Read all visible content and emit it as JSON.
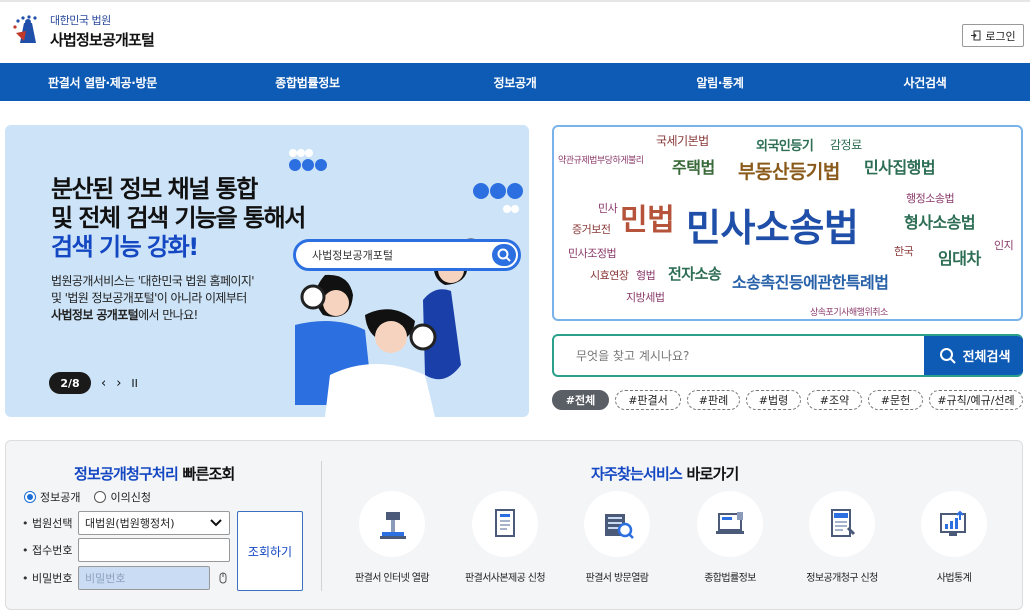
{
  "header": {
    "logo_small": "대한민국 법원",
    "logo_big": "사법정보공개포털",
    "login_label": "로그인"
  },
  "nav": {
    "items": [
      {
        "label": "판결서 열람·제공·방문"
      },
      {
        "label": "종합법률정보"
      },
      {
        "label": "정보공개"
      },
      {
        "label": "알림·통계"
      },
      {
        "label": "사건검색"
      }
    ]
  },
  "banner": {
    "headline_line1": "분산된 정보 채널 통합",
    "headline_line2": "및 전체 검색 기능을 통해서",
    "headline_line3": "검색 기능 강화!",
    "body_line1": "법원공개서비스는 '대한민국 법원 홈페이지'",
    "body_line2": "및 '법원 정보공개포털'이 아니라 이제부터",
    "body_line3_bold": "사법정보 공개포털",
    "body_line3_rest": "에서 만나요!",
    "search_text": "사법정보공개포털",
    "pager": "2/8",
    "prev": "‹",
    "next": "›",
    "pause": "II"
  },
  "word_cloud": {
    "words": [
      {
        "text": "국세기본법",
        "color": "#8a3a3a"
      },
      {
        "text": "외국인등기",
        "color": "#2d6e55"
      },
      {
        "text": "감정료",
        "color": "#2d6e55"
      },
      {
        "text": "약관규제법부당하게불리",
        "color": "#8a3a6a"
      },
      {
        "text": "주택법",
        "color": "#3a6a3a"
      },
      {
        "text": "부동산등기법",
        "color": "#8a5a1a"
      },
      {
        "text": "민사집행법",
        "color": "#2d6e55"
      },
      {
        "text": "행정소송법",
        "color": "#8a3a6a"
      },
      {
        "text": "민사",
        "color": "#8a3a6a"
      },
      {
        "text": "민법",
        "color": "#b5543a"
      },
      {
        "text": "민사소송법",
        "color": "#1f4fa8"
      },
      {
        "text": "형사소송법",
        "color": "#2d6e55"
      },
      {
        "text": "증거보전",
        "color": "#8a3a3a"
      },
      {
        "text": "민사조정법",
        "color": "#8a3a6a"
      },
      {
        "text": "한국",
        "color": "#8a3a3a"
      },
      {
        "text": "임대차",
        "color": "#2d6e55"
      },
      {
        "text": "인지",
        "color": "#8a3a6a"
      },
      {
        "text": "시효연장",
        "color": "#8a3a3a"
      },
      {
        "text": "형법",
        "color": "#8a3a6a"
      },
      {
        "text": "전자소송",
        "color": "#2d6e55"
      },
      {
        "text": "소송촉진등에관한특례법",
        "color": "#2660a8"
      },
      {
        "text": "지방세법",
        "color": "#8a3a6a"
      },
      {
        "text": "상속포기사해행위취소",
        "color": "#8a3a6a"
      }
    ]
  },
  "search": {
    "placeholder": "무엇을 찾고 계시나요?",
    "button_label": "전체검색"
  },
  "tags": [
    {
      "label": "#전체",
      "active": true
    },
    {
      "label": "#판결서",
      "active": false
    },
    {
      "label": "#판례",
      "active": false
    },
    {
      "label": "#법령",
      "active": false
    },
    {
      "label": "#조약",
      "active": false
    },
    {
      "label": "#문헌",
      "active": false
    },
    {
      "label": "#규칙/예규/선례",
      "active": false
    }
  ],
  "quick": {
    "title_blue": "정보공개청구처리",
    "title_rest": " 빠른조회",
    "radio1": "정보공개",
    "radio2": "이의신청",
    "court_label": "법원선택",
    "court_value": "대법원(법원행정처)",
    "receipt_label": "접수번호",
    "password_label": "비밀번호",
    "password_placeholder": "비밀번호",
    "query_button": "조회하기"
  },
  "frequent": {
    "title_blue": "자주찾는서비스",
    "title_rest": " 바로가기",
    "items": [
      {
        "label": "판결서 인터넷 열람",
        "icon": "gavel-icon"
      },
      {
        "label": "판결서사본제공 신청",
        "icon": "document-icon"
      },
      {
        "label": "판결서 방문열람",
        "icon": "building-search-icon"
      },
      {
        "label": "종합법률정보",
        "icon": "laptop-icon"
      },
      {
        "label": "정보공개청구 신청",
        "icon": "open-folder-icon"
      },
      {
        "label": "사법통계",
        "icon": "monitor-chart-icon"
      }
    ]
  }
}
